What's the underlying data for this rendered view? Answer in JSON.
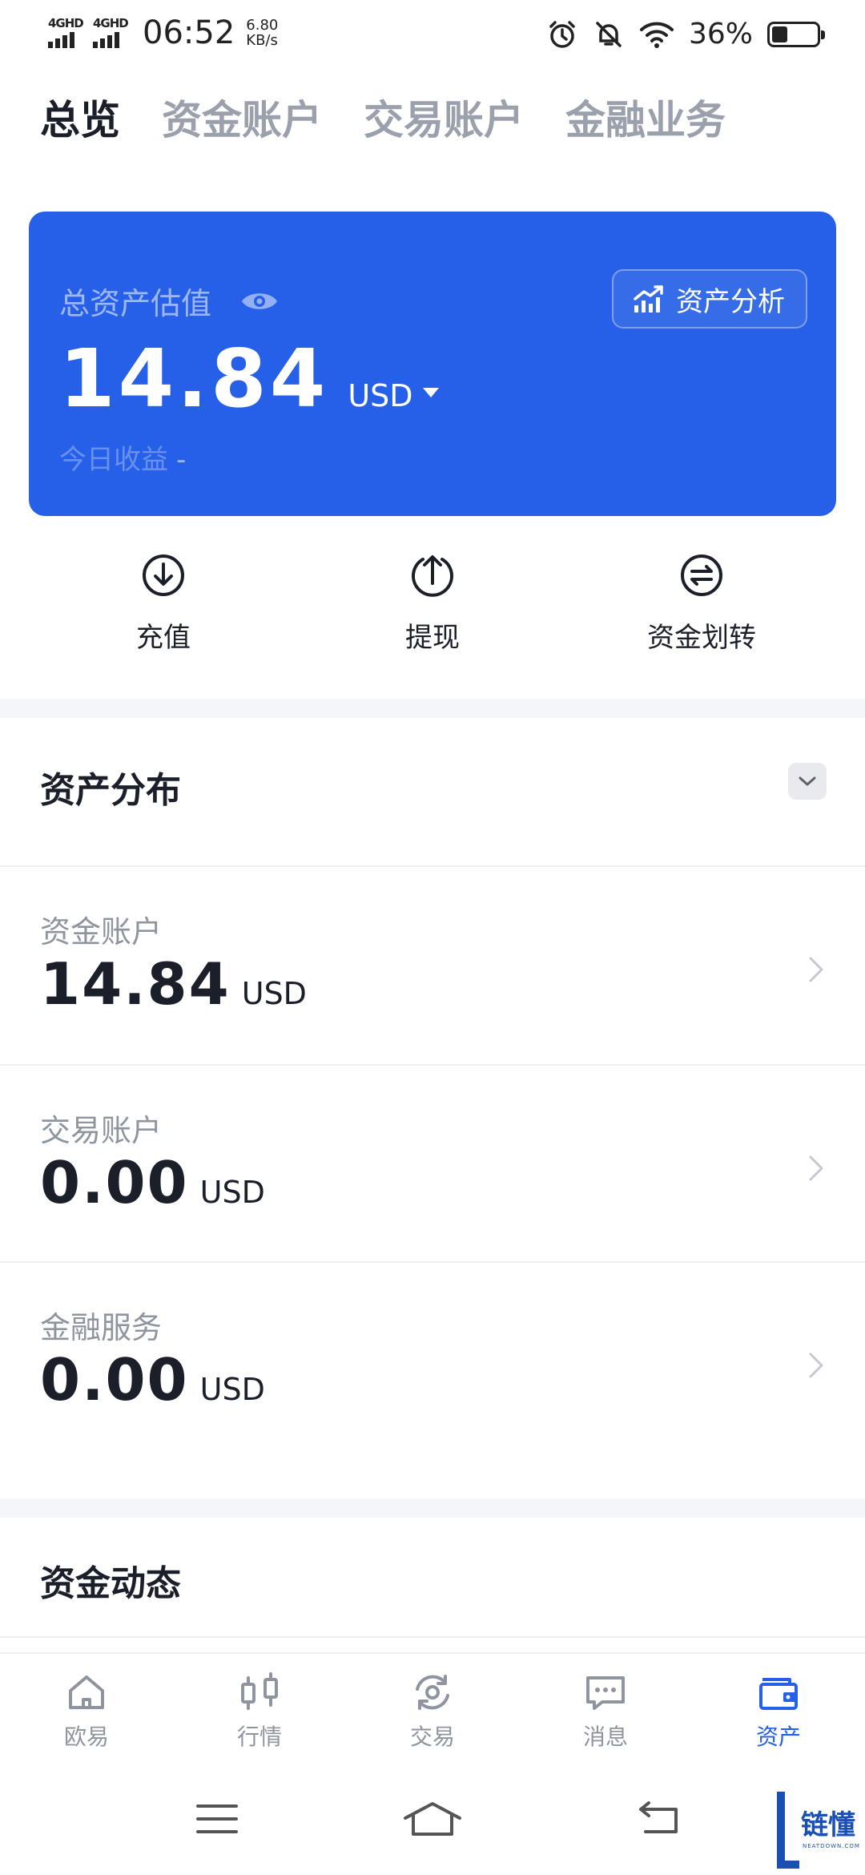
{
  "status_bar": {
    "signal_1": "4GHD",
    "signal_2": "4GHD",
    "time": "06:52",
    "speed_value": "6.80",
    "speed_unit": "KB/s",
    "battery_percent": "36%",
    "battery_level": 0.36,
    "icons": [
      "alarm-icon",
      "mute-bell-icon",
      "wifi-icon",
      "battery-icon"
    ]
  },
  "top_tabs": [
    {
      "label": "总览",
      "active": true
    },
    {
      "label": "资金账户",
      "active": false
    },
    {
      "label": "交易账户",
      "active": false
    },
    {
      "label": "金融业务",
      "active": false
    }
  ],
  "asset_card": {
    "label": "总资产估值",
    "analysis_button": "资产分析",
    "total_value": "14.84",
    "currency": "USD",
    "today_label": "今日收益",
    "today_value": "-",
    "colors": {
      "background": "#2760e8"
    }
  },
  "quick_actions": [
    {
      "label": "充值",
      "icon": "deposit-icon"
    },
    {
      "label": "提现",
      "icon": "withdraw-icon"
    },
    {
      "label": "资金划转",
      "icon": "transfer-icon"
    }
  ],
  "distribution": {
    "title": "资产分布",
    "accounts": [
      {
        "name": "资金账户",
        "value": "14.84",
        "unit": "USD"
      },
      {
        "name": "交易账户",
        "value": "0.00",
        "unit": "USD"
      },
      {
        "name": "金融服务",
        "value": "0.00",
        "unit": "USD"
      }
    ]
  },
  "fund_flow": {
    "title": "资金动态"
  },
  "bottom_nav": [
    {
      "label": "欧易",
      "icon": "home-icon",
      "active": false
    },
    {
      "label": "行情",
      "icon": "candlestick-icon",
      "active": false
    },
    {
      "label": "交易",
      "icon": "trade-icon",
      "active": false
    },
    {
      "label": "消息",
      "icon": "message-icon",
      "active": false
    },
    {
      "label": "资产",
      "icon": "wallet-icon",
      "active": true
    }
  ],
  "watermark": {
    "text": "链懂",
    "sub": "NEATDOWN.COM"
  }
}
